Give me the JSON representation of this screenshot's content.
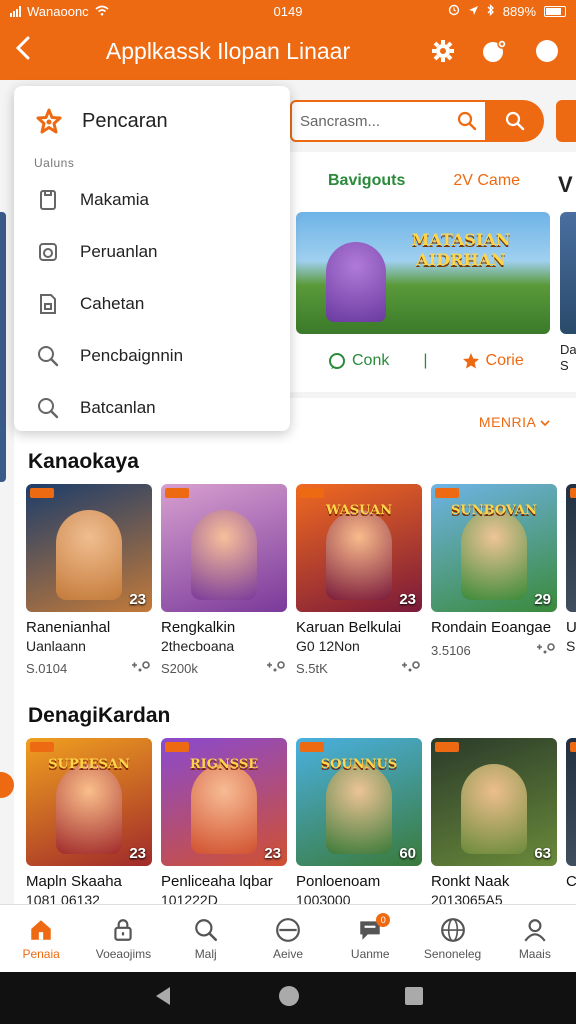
{
  "status_bar": {
    "carrier": "Wanaoonc",
    "time": "0149",
    "battery": "889%"
  },
  "app_bar": {
    "title": "Applkassk Ilopan Linaar"
  },
  "search": {
    "placeholder": "Sancrasm..."
  },
  "featured": {
    "tabs": [
      "Bavigouts",
      "2V Came",
      "V"
    ],
    "banner_text": "MATASIAN AIDRHAN",
    "actions": [
      "Conk",
      "Corie"
    ],
    "cut_text": "Da S"
  },
  "menu": {
    "header": "Pencaran",
    "section_label": "Ualuns",
    "items": [
      {
        "label": "Makamia",
        "icon": "phone-icon"
      },
      {
        "label": "Peruanlan",
        "icon": "clock-icon"
      },
      {
        "label": "Cahetan",
        "icon": "document-icon"
      },
      {
        "label": "Pencbaignnin",
        "icon": "search-icon"
      },
      {
        "label": "Batcanlan",
        "icon": "search-icon"
      }
    ]
  },
  "sort_label": "MENRIA",
  "sections": [
    {
      "title": "Kanaokaya",
      "cards": [
        {
          "name": "Ranenianhal",
          "sub": "Uanlaann",
          "price": "S.0104",
          "rating": "23",
          "colors": [
            "#1d3d6a",
            "#c27a3a"
          ]
        },
        {
          "name": "Rengkalkin",
          "sub": "2thecboana",
          "price": "S200k",
          "rating": "",
          "colors": [
            "#d8a0d0",
            "#7a3a9a"
          ]
        },
        {
          "name": "Karuan Belkulai",
          "sub": "G0 12Non",
          "price": "S.5tK",
          "rating": "23",
          "colors": [
            "#f06a20",
            "#7a1a3a"
          ],
          "logo": "WASUAN"
        },
        {
          "name": "Rondain Eoangae",
          "sub": "",
          "price": "3.5106",
          "rating": "29",
          "colors": [
            "#6fb3e6",
            "#3a8a3a"
          ],
          "logo": "SUNBOVAN"
        },
        {
          "name": "Ul",
          "sub": "Sa",
          "price": "",
          "rating": "",
          "colors": [
            "#203040",
            "#405060"
          ]
        }
      ]
    },
    {
      "title": "DenagiKardan",
      "cards": [
        {
          "name": "Mapln Skaaha",
          "sub": "1081 06132",
          "price": "",
          "rating": "23",
          "colors": [
            "#f0a020",
            "#a02a2a"
          ],
          "logo": "SUPEESAN"
        },
        {
          "name": "Penliceaha lqbar",
          "sub": "101222D",
          "price": "",
          "rating": "23",
          "colors": [
            "#8a4ad0",
            "#d05030"
          ],
          "logo": "RIGNSSE"
        },
        {
          "name": "Ponloenoam",
          "sub": "1003000",
          "price": "",
          "rating": "60",
          "colors": [
            "#4ab0e0",
            "#3a7a3a"
          ],
          "logo": "SOUNNUS"
        },
        {
          "name": "Ronkt Naak",
          "sub": "2013065A5",
          "price": "",
          "rating": "63",
          "colors": [
            "#2a3a2a",
            "#6a8a3a"
          ]
        },
        {
          "name": "C",
          "sub": "",
          "price": "",
          "rating": "",
          "colors": [
            "#203040",
            "#405060"
          ]
        }
      ]
    }
  ],
  "bottom_nav": [
    {
      "label": "Penaia",
      "icon": "home-icon",
      "active": true
    },
    {
      "label": "Voeaojims",
      "icon": "lock-icon"
    },
    {
      "label": "Malj",
      "icon": "search-icon"
    },
    {
      "label": "Aeive",
      "icon": "circle-icon"
    },
    {
      "label": "Uanme",
      "icon": "chat-icon",
      "badge": "0"
    },
    {
      "label": "Senoneleg",
      "icon": "globe-icon"
    },
    {
      "label": "Maais",
      "icon": "user-icon"
    }
  ],
  "colors": {
    "accent": "#ee6a12",
    "green": "#2a8a3a"
  }
}
